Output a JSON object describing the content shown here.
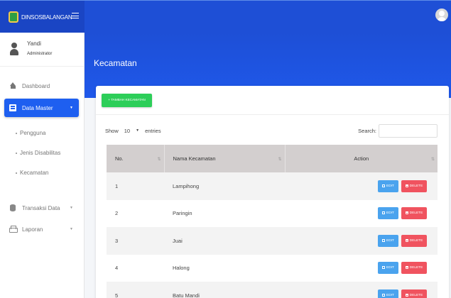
{
  "brand": {
    "name": "DINSOSBALANGAN"
  },
  "user": {
    "name": "Yandi",
    "role": "Administrator"
  },
  "nav": {
    "dashboard": "Dashboard",
    "data_master": "Data Master",
    "submenu": [
      "Pengguna",
      "Jenis Disabilitas",
      "Kecamatan"
    ],
    "transaksi": "Transaksi Data",
    "laporan": "Laporan"
  },
  "page": {
    "title": "Kecamatan"
  },
  "toolbar": {
    "add_label": "TAMBAH KECAMATAN"
  },
  "datatable": {
    "show_label": "Show",
    "entries_value": "10",
    "entries_label": "entries",
    "search_label": "Search:",
    "columns": [
      "No.",
      "Nama Kecamatan",
      "Action"
    ],
    "rows": [
      {
        "no": "1",
        "name": "Lampihong"
      },
      {
        "no": "2",
        "name": "Paringin"
      },
      {
        "no": "3",
        "name": "Juai"
      },
      {
        "no": "4",
        "name": "Halong"
      },
      {
        "no": "5",
        "name": "Batu Mandi"
      }
    ],
    "edit_label": "EDIT",
    "delete_label": "DELETE"
  },
  "colors": {
    "navbar": "#1e4fd6",
    "active_nav": "#1e5ff0",
    "add_button": "#2dce59",
    "edit_button": "#4aa3ee",
    "delete_button": "#f0535f"
  }
}
